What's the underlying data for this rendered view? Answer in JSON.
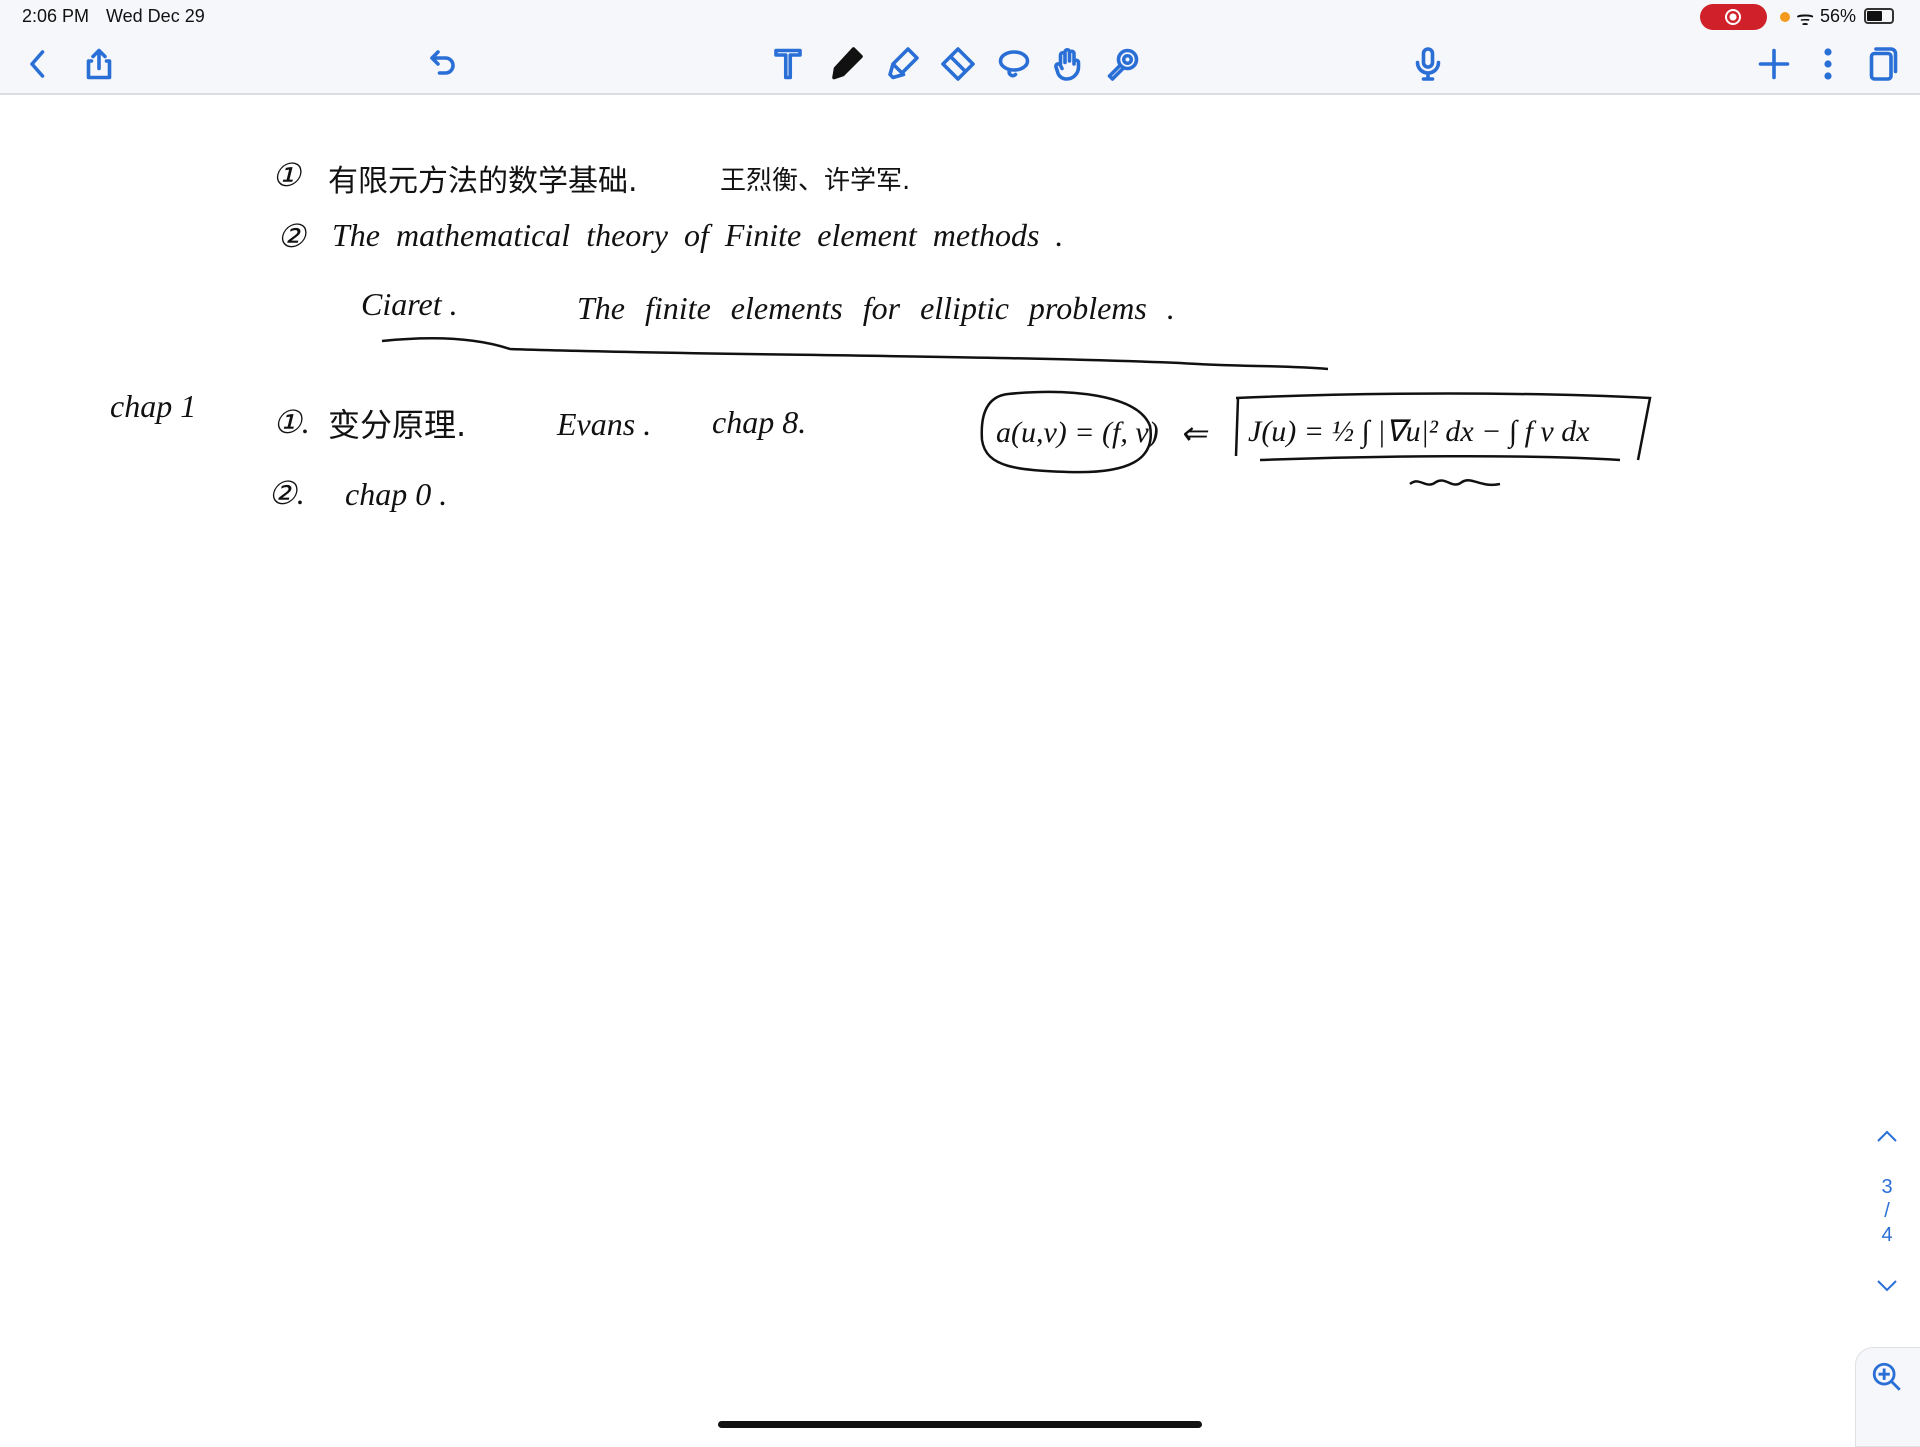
{
  "status_bar": {
    "time": "2:06 PM",
    "date": "Wed Dec 29",
    "battery": "56%",
    "battery_level": 0.56,
    "recording_color": "#d0212b"
  },
  "toolbar": {
    "icons": [
      "back-icon",
      "share-icon",
      "undo-icon",
      "text-tool-icon",
      "pen-icon",
      "highlighter-icon",
      "eraser-icon",
      "lasso-icon",
      "hand-icon",
      "laser-pointer-icon",
      "microphone-icon",
      "add-icon",
      "more-icon",
      "pages-icon"
    ],
    "accent": "#2a6fd6"
  },
  "note": {
    "line1": {
      "num": "①",
      "zh": "有限元方法的数学基础.",
      "authors": "王烈衡、许学军."
    },
    "line2": {
      "num": "②",
      "text": "The   mathematical   theory of   Finite   element   methods ."
    },
    "line3": {
      "author": "Ciaret .",
      "title": "The  finite  elements  for  elliptic  problems ."
    },
    "chap1": "chap 1",
    "line4": {
      "num": "①.",
      "zh": "变分原理.",
      "ref": "Evans .",
      "chap": "chap 8.",
      "oval": "a(u,v) = (f, v)",
      "arrow": "⇐",
      "boxed": "J(u) = ½ ∫ |∇u|² dx −  ∫ f v dx"
    },
    "line5": {
      "num": "②.",
      "text": "chap 0 ."
    }
  },
  "pager": {
    "current": "3",
    "sep": "/",
    "total": "4"
  }
}
